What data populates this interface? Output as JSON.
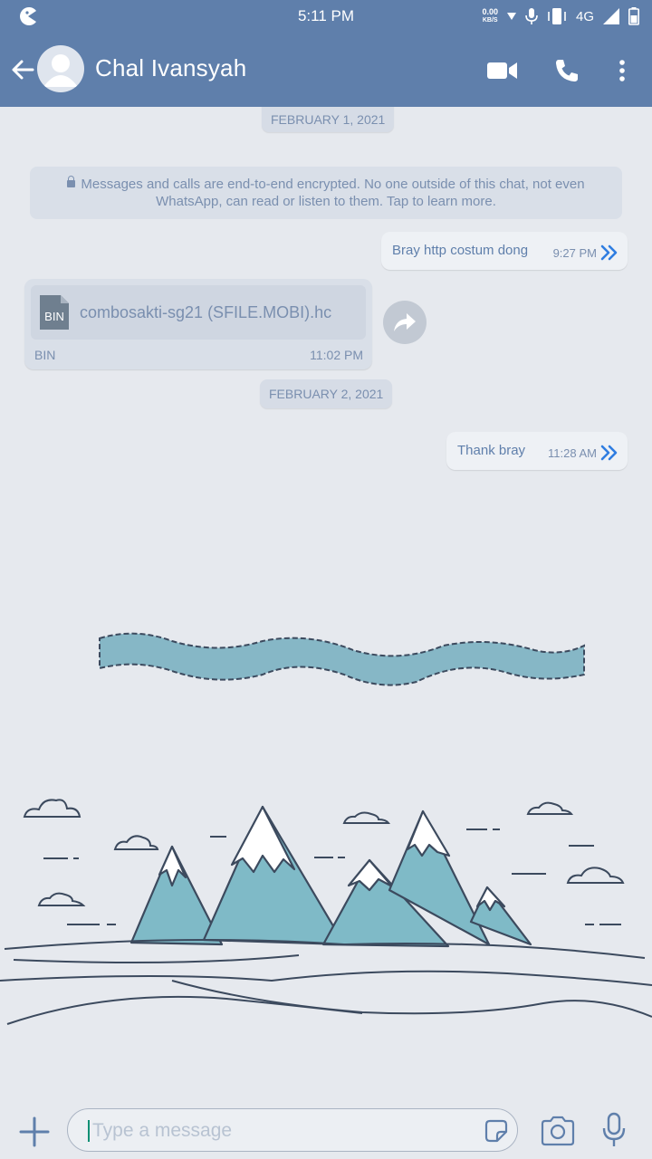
{
  "status_bar": {
    "time": "5:11 PM",
    "net_speed_value": "0.00",
    "net_speed_unit": "KB/S",
    "network": "4G"
  },
  "header": {
    "contact_name": "Chal Ivansyah",
    "icons": [
      "back-arrow-icon",
      "avatar",
      "video-call-icon",
      "phone-icon",
      "more-vert-icon"
    ]
  },
  "chat": {
    "date_top": "FEBRUARY 1, 2021",
    "encryption_notice": "Messages and calls are end-to-end encrypted. No one outside of this chat, not even WhatsApp, can read or listen to them. Tap to learn more.",
    "messages": [
      {
        "direction": "out",
        "text": "Bray http costum dong",
        "time": "9:27 PM",
        "status": "read"
      },
      {
        "direction": "in",
        "type": "file",
        "file_icon_label": "BIN",
        "file_name": "combosakti-sg21 (SFILE.MOBI).hc",
        "file_type": "BIN",
        "time": "11:02 PM"
      },
      {
        "direction": "out",
        "text": "Thank bray",
        "time": "11:28 AM",
        "status": "read"
      }
    ],
    "date_second": "FEBRUARY 2, 2021"
  },
  "input": {
    "placeholder": "Type a message",
    "value": ""
  },
  "colors": {
    "header": "#5f7fab",
    "background": "#e6e9ee",
    "read_ticks": "#2f7de1",
    "mountain": "#7fbac7"
  }
}
